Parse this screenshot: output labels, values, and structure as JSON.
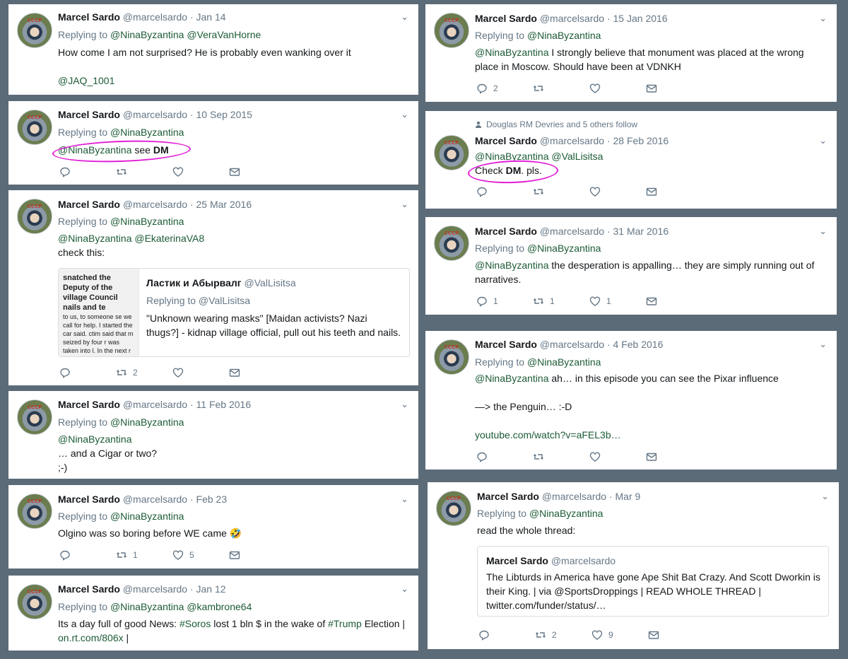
{
  "author_name": "Marcel Sardo",
  "author_handle": "@marcelsardo",
  "replying_prefix": "Replying to",
  "chevron": "⌄",
  "tweets": {
    "t1": {
      "date": "· Jan 14",
      "replying": "@NinaByzantina @VeraVanHorne",
      "line1": "How come I am not surprised? He is probably even wanking over it",
      "link": "@JAQ_1001"
    },
    "t2": {
      "date": "· 10 Sep 2015",
      "replying": "@NinaByzantina",
      "mention": "@NinaByzantina",
      "mid": " see ",
      "bold": "DM"
    },
    "t3": {
      "date": "· 25 Mar 2016",
      "replying": "@NinaByzantina",
      "mentions": "@NinaByzantina @EkaterinaVA8",
      "line": "check this:",
      "retweets": "2",
      "quote": {
        "name": "Ластик и Абырвалг",
        "handle": "@ValLisitsa",
        "replying": "Replying to @ValLisitsa",
        "text": "\"Unknown wearing masks\" [Maidan activists? Nazi thugs?] - kidnap village official, pull out his teeth and nails.",
        "thumb_head": "snatched the Deputy of the village Council nails and te",
        "thumb_body": "to us, to someone se we call for help. I started the car said. ctim said that m seized by four r was taken into l. In the next r"
      }
    },
    "t4": {
      "date": "· 11 Feb 2016",
      "replying": "@NinaByzantina",
      "mention": "@NinaByzantina",
      "line2": "… and a Cigar or two?",
      "line3": ";-)"
    },
    "t5": {
      "date": "· Feb 23",
      "replying": "@NinaByzantina",
      "line": "Olgino was so boring before WE came 🤣",
      "retweets": "1",
      "likes": "5"
    },
    "t6": {
      "date": "· Jan 12",
      "replying": "@NinaByzantina @kambrone64",
      "pre": "Its a day full of good News: ",
      "tag1": "#Soros",
      "mid": " lost 1 bln $ in the wake of ",
      "tag2": "#Trump",
      "post": " Election |",
      "link": "on.rt.com/806x",
      "tail": " |"
    },
    "t7": {
      "date": "· 15 Jan 2016",
      "replying": "@NinaByzantina",
      "mention": "@NinaByzantina",
      "line": " I strongly believe that monument was placed at the wrong place in Moscow. Should have been at VDNKH",
      "replies": "2"
    },
    "t8": {
      "social": "Douglas RM Devries and 5 others follow",
      "date": "· 28 Feb 2016",
      "mentions": "@NinaByzantina @ValLisitsa",
      "pre": "Check ",
      "bold": "DM",
      "post": ". pls."
    },
    "t9": {
      "date": "· 31 Mar 2016",
      "replying": "@NinaByzantina",
      "mention": "@NinaByzantina",
      "line": " the desperation is appalling… they are simply running out of narratives.",
      "replies": "1",
      "retweets": "1",
      "likes": "1"
    },
    "t10": {
      "date": "· 4 Feb 2016",
      "replying": "@NinaByzantina",
      "mention": "@NinaByzantina",
      "line": " ah… in this episode you can see the Pixar influence",
      "line2": "—> the Penguin… :-D",
      "link": "youtube.com/watch?v=aFEL3b…"
    },
    "t11": {
      "date": "· Mar 9",
      "replying": "@NinaByzantina",
      "line": "read the whole thread:",
      "retweets": "2",
      "likes": "9",
      "quote": {
        "name": "Marcel Sardo",
        "handle": "@marcelsardo",
        "text": "The Libturds in America have gone Ape Shit Bat Crazy. And Scott Dworkin is their King. | via @SportsDroppings | READ WHOLE THREAD | twitter.com/funder/status/…"
      }
    }
  }
}
